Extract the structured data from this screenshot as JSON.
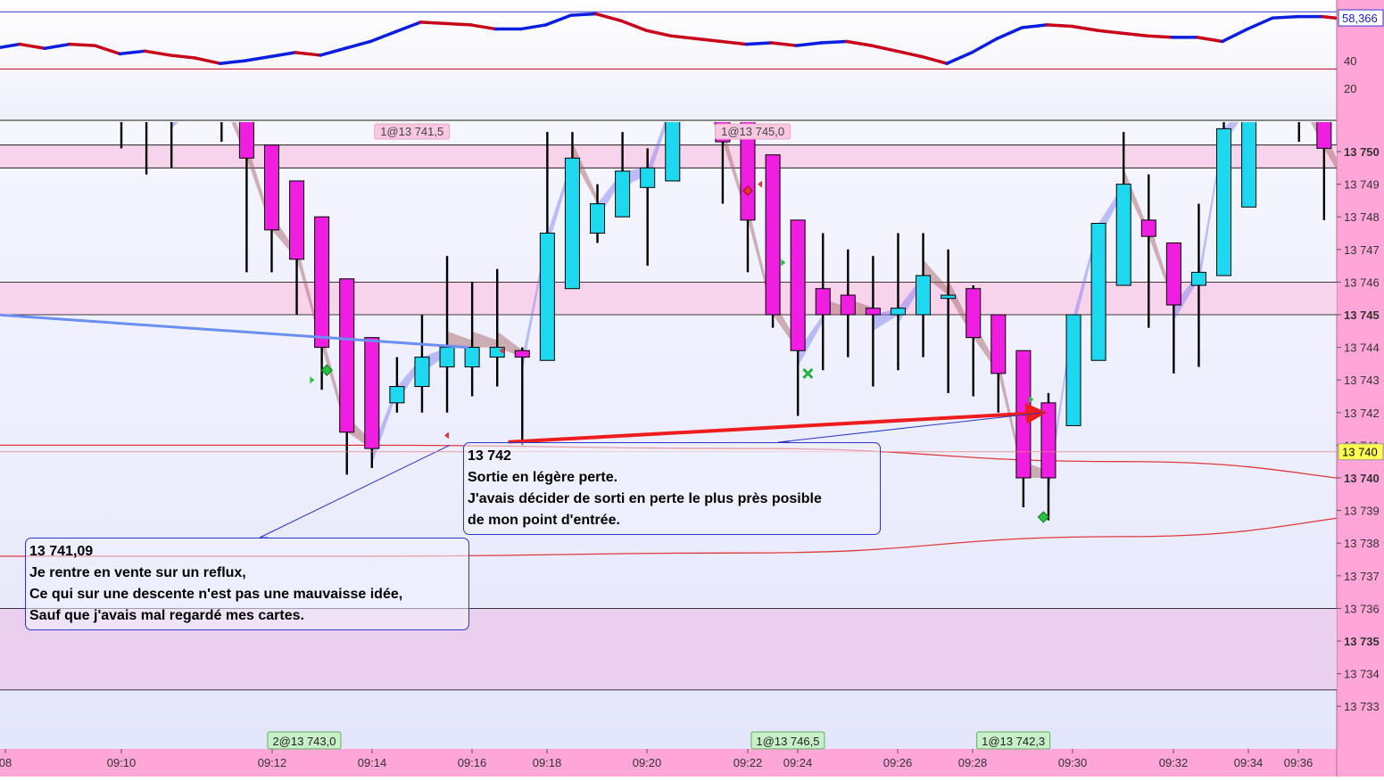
{
  "colors": {
    "bull": "#1ed8f0",
    "bear": "#f01ee0",
    "grid_line": "#000000",
    "upper_band": "#f7d4ec",
    "lower_band": "#ead0ee",
    "axis_bg": "#ffa6d8",
    "osc_up": "#0a1ee0",
    "osc_down": "#c8001a",
    "arrow": "#ee1c1c"
  },
  "chart_data": {
    "type": "candlestick",
    "ylim": [
      13732.2,
      13750.9
    ],
    "y_ticks": [
      "13 750",
      "13 749",
      "13 748",
      "13 747",
      "13 746",
      "13 745",
      "13 744",
      "13 743",
      "13 742",
      "13 741",
      "13 740",
      "13 739",
      "13 738",
      "13 737",
      "13 736",
      "13 735",
      "13 734",
      "13 733"
    ],
    "bold_ticks": [
      "13 750",
      "13 745",
      "13 740",
      "13 735"
    ],
    "x_ticks": [
      "08",
      "09:10",
      "09:12",
      "09:14",
      "09:16",
      "09:18",
      "09:20",
      "09:22",
      "09:24",
      "09:26",
      "09:28",
      "09:30",
      "09:32",
      "09:34",
      "09:36"
    ],
    "price_label": "13 740",
    "horizontal_levels": [
      13750.2,
      13749.5,
      13746.0,
      13745.0,
      13736.0,
      13733.5
    ],
    "candles": [
      {
        "t": 0,
        "o": 13751.8,
        "h": 13751.9,
        "l": 13750.1,
        "c": 13751.6
      },
      {
        "t": 1,
        "o": 13751.5,
        "h": 13751.8,
        "l": 13749.3,
        "c": 13751.5
      },
      {
        "t": 2,
        "o": 13751.5,
        "h": 13751.8,
        "l": 13749.5,
        "c": 13751.2
      },
      {
        "t": 3,
        "o": 13751.6,
        "h": 13751.8,
        "l": 13750.9,
        "c": 13751.6
      },
      {
        "t": 4,
        "o": 13751.6,
        "h": 13751.8,
        "l": 13750.3,
        "c": 13751.6
      },
      {
        "t": 5,
        "o": 13751.6,
        "h": 13751.6,
        "l": 13746.3,
        "c": 13749.8
      },
      {
        "t": 6,
        "o": 13750.2,
        "h": 13750.2,
        "l": 13746.3,
        "c": 13747.6
      },
      {
        "t": 7,
        "o": 13749.1,
        "h": 13749.1,
        "l": 13745.0,
        "c": 13746.7
      },
      {
        "t": 8,
        "o": 13748.0,
        "h": 13748.0,
        "l": 13742.7,
        "c": 13744.0
      },
      {
        "t": 9,
        "o": 13746.1,
        "h": 13746.1,
        "l": 13740.1,
        "c": 13741.4
      },
      {
        "t": 10,
        "o": 13744.3,
        "h": 13744.3,
        "l": 13740.3,
        "c": 13740.9
      },
      {
        "t": 11,
        "o": 13742.3,
        "h": 13743.7,
        "l": 13742.0,
        "c": 13742.8
      },
      {
        "t": 12,
        "o": 13742.8,
        "h": 13745.0,
        "l": 13742.0,
        "c": 13743.7
      },
      {
        "t": 13,
        "o": 13743.4,
        "h": 13746.8,
        "l": 13742.0,
        "c": 13744.0
      },
      {
        "t": 14,
        "o": 13743.4,
        "h": 13746.0,
        "l": 13742.5,
        "c": 13744.0
      },
      {
        "t": 15,
        "o": 13743.7,
        "h": 13746.4,
        "l": 13742.8,
        "c": 13744.0
      },
      {
        "t": 16,
        "o": 13743.9,
        "h": 13744.0,
        "l": 13741.0,
        "c": 13743.7
      },
      {
        "t": 17,
        "o": 13743.6,
        "h": 13750.6,
        "l": 13743.6,
        "c": 13747.5
      },
      {
        "t": 18,
        "o": 13745.8,
        "h": 13750.6,
        "l": 13745.8,
        "c": 13749.8
      },
      {
        "t": 19,
        "o": 13747.5,
        "h": 13749.0,
        "l": 13747.2,
        "c": 13748.4
      },
      {
        "t": 20,
        "o": 13748.0,
        "h": 13750.6,
        "l": 13748.0,
        "c": 13749.4
      },
      {
        "t": 21,
        "o": 13748.9,
        "h": 13750.1,
        "l": 13746.5,
        "c": 13749.5
      },
      {
        "t": 22,
        "o": 13749.1,
        "h": 13751.8,
        "l": 13749.1,
        "c": 13751.6
      },
      {
        "t": 23,
        "o": 13751.7,
        "h": 13751.9,
        "l": 13751.0,
        "c": 13751.8
      },
      {
        "t": 24,
        "o": 13751.6,
        "h": 13751.8,
        "l": 13748.4,
        "c": 13750.3
      },
      {
        "t": 25,
        "o": 13751.6,
        "h": 13751.8,
        "l": 13746.3,
        "c": 13747.9
      },
      {
        "t": 26,
        "o": 13749.9,
        "h": 13749.9,
        "l": 13744.6,
        "c": 13745.0
      },
      {
        "t": 27,
        "o": 13747.9,
        "h": 13747.9,
        "l": 13741.9,
        "c": 13743.9
      },
      {
        "t": 28,
        "o": 13745.8,
        "h": 13747.5,
        "l": 13743.3,
        "c": 13745.0
      },
      {
        "t": 29,
        "o": 13745.6,
        "h": 13747.0,
        "l": 13743.7,
        "c": 13745.0
      },
      {
        "t": 30,
        "o": 13745.2,
        "h": 13746.8,
        "l": 13742.8,
        "c": 13745.0
      },
      {
        "t": 31,
        "o": 13745.0,
        "h": 13747.5,
        "l": 13743.3,
        "c": 13745.2
      },
      {
        "t": 32,
        "o": 13745.0,
        "h": 13747.5,
        "l": 13743.7,
        "c": 13746.2
      },
      {
        "t": 33,
        "o": 13745.5,
        "h": 13747.0,
        "l": 13742.6,
        "c": 13745.6
      },
      {
        "t": 34,
        "o": 13745.8,
        "h": 13745.9,
        "l": 13742.5,
        "c": 13744.3
      },
      {
        "t": 35,
        "o": 13745.0,
        "h": 13745.0,
        "l": 13742.0,
        "c": 13743.2
      },
      {
        "t": 36,
        "o": 13743.9,
        "h": 13743.9,
        "l": 13739.1,
        "c": 13740.0
      },
      {
        "t": 37,
        "o": 13742.3,
        "h": 13742.6,
        "l": 13738.7,
        "c": 13740.0
      },
      {
        "t": 38,
        "o": 13741.6,
        "h": 13745.0,
        "l": 13741.6,
        "c": 13745.0
      },
      {
        "t": 39,
        "o": 13743.6,
        "h": 13747.2,
        "l": 13743.6,
        "c": 13747.8
      },
      {
        "t": 40,
        "o": 13745.9,
        "h": 13750.6,
        "l": 13745.9,
        "c": 13749.0
      },
      {
        "t": 41,
        "o": 13747.9,
        "h": 13749.3,
        "l": 13744.6,
        "c": 13747.4
      },
      {
        "t": 42,
        "o": 13747.2,
        "h": 13747.2,
        "l": 13743.2,
        "c": 13745.3
      },
      {
        "t": 43,
        "o": 13745.9,
        "h": 13748.4,
        "l": 13743.4,
        "c": 13746.3
      },
      {
        "t": 44,
        "o": 13746.2,
        "h": 13751.8,
        "l": 13746.2,
        "c": 13750.7
      },
      {
        "t": 45,
        "o": 13748.3,
        "h": 13751.8,
        "l": 13748.3,
        "c": 13751.6
      },
      {
        "t": 46,
        "o": 13751.6,
        "h": 13751.8,
        "l": 13751.0,
        "c": 13751.8
      },
      {
        "t": 47,
        "o": 13751.6,
        "h": 13751.8,
        "l": 13750.3,
        "c": 13751.6
      },
      {
        "t": 48,
        "o": 13751.6,
        "h": 13751.8,
        "l": 13747.9,
        "c": 13750.1
      },
      {
        "t": 49,
        "o": 13751.6,
        "h": 13751.8,
        "l": 13747.0,
        "c": 13748.8
      },
      {
        "t": 50,
        "o": 13749.9,
        "h": 13749.9,
        "l": 13746.3,
        "c": 13748.0
      },
      {
        "t": 51,
        "o": 13748.6,
        "h": 13749.0,
        "l": 13747.0,
        "c": 13748.0
      },
      {
        "t": 52,
        "o": 13748.5,
        "h": 13751.8,
        "l": 13747.0,
        "c": 13749.4
      },
      {
        "t": 53,
        "o": 13749.0,
        "h": 13751.8,
        "l": 13749.0,
        "c": 13751.6
      },
      {
        "t": 54,
        "o": 13751.6,
        "h": 13751.8,
        "l": 13751.2,
        "c": 13751.8
      }
    ],
    "trend_lines": [
      {
        "color": "#6a8ff0",
        "width": 3,
        "p1": {
          "t": -5,
          "v": 13745.0
        },
        "p2": {
          "t": 13.8,
          "v": 13744.0
        }
      },
      {
        "color": "#ee1c1c",
        "width": 4,
        "arrow": true,
        "p1": {
          "t": 15.5,
          "v": 13741.1
        },
        "p2": {
          "t": 36.8,
          "v": 13742.0
        }
      }
    ],
    "curves": [
      {
        "color": "#e0393b",
        "width": 1.3,
        "points": [
          {
            "t": -5,
            "v": 13741.0
          },
          {
            "t": 10,
            "v": 13741.0
          },
          {
            "t": 25,
            "v": 13740.9
          },
          {
            "t": 40,
            "v": 13740.5
          },
          {
            "t": 55,
            "v": 13739.7
          }
        ]
      },
      {
        "color": "#e0393b",
        "width": 1.3,
        "points": [
          {
            "t": -5,
            "v": 13737.6
          },
          {
            "t": 10,
            "v": 13737.6
          },
          {
            "t": 25,
            "v": 13737.7
          },
          {
            "t": 40,
            "v": 13738.2
          },
          {
            "t": 55,
            "v": 13739.1
          }
        ]
      }
    ],
    "trade_boxes": [
      {
        "label": "1@13 741,5",
        "t": 11.6,
        "v": 13750.5,
        "fill": "#f7c8e0",
        "stroke": "#e8a8c8"
      },
      {
        "label": "1@13 745,0",
        "t": 25.2,
        "v": 13750.5,
        "fill": "#f7c8e0",
        "stroke": "#e8a8c8"
      }
    ],
    "bottom_boxes": [
      {
        "label": "2@13 743,0",
        "t": 7.3
      },
      {
        "label": "1@13 746,5",
        "t": 26.6
      },
      {
        "label": "1@13 742,3",
        "t": 35.6
      }
    ],
    "markers": [
      {
        "type": "diamond-green",
        "t": 8.2,
        "v": 13743.3
      },
      {
        "type": "diamond-green",
        "t": 36.8,
        "v": 13738.8
      },
      {
        "type": "x-green",
        "t": 27.4,
        "v": 13743.2
      },
      {
        "type": "diamond-red",
        "t": 25.0,
        "v": 13748.8
      },
      {
        "type": "tri-green",
        "t": 7.6,
        "v": 13743.0
      },
      {
        "type": "tri-green",
        "t": 26.4,
        "v": 13746.6
      },
      {
        "type": "tri-green",
        "t": 36.3,
        "v": 13742.4
      },
      {
        "type": "tri-red",
        "t": 13.0,
        "v": 13741.3
      },
      {
        "type": "tri-red",
        "t": 25.5,
        "v": 13749.0
      },
      {
        "type": "tri-red",
        "t": 15.2,
        "v": 13743.9
      }
    ],
    "oscillator": {
      "ylim": [
        0,
        75
      ],
      "ticks": [
        "40",
        "20"
      ],
      "label": "58,366",
      "upper_level": 75.5,
      "lower_level": 34,
      "values": [
        49,
        52,
        49,
        52,
        51,
        45,
        47,
        44,
        42,
        38,
        40,
        43,
        46,
        44,
        49,
        54,
        61,
        68,
        67,
        66,
        63,
        63,
        66,
        73,
        74,
        69,
        62,
        58,
        56,
        54,
        52,
        53,
        51,
        53,
        54,
        51,
        47,
        43,
        38,
        46,
        56,
        64,
        66,
        65,
        62,
        60,
        58,
        57,
        57,
        54,
        63,
        71,
        72,
        72,
        70,
        66,
        64,
        62,
        63,
        66,
        71,
        68,
        72,
        73
      ]
    },
    "annotations": [
      {
        "id": "entry",
        "lines": [
          "13 741,09",
          "Je rentre en vente sur un reflux,",
          "Ce qui sur une descente n'est pas une mauvaisse idée,",
          "Sauf que j'avais mal regardé mes cartes."
        ]
      },
      {
        "id": "exit",
        "lines": [
          "13 742",
          "Sortie en légère perte.",
          "J'avais décider de sorti en perte le plus près posible",
          "de mon point d'entrée."
        ]
      }
    ]
  }
}
